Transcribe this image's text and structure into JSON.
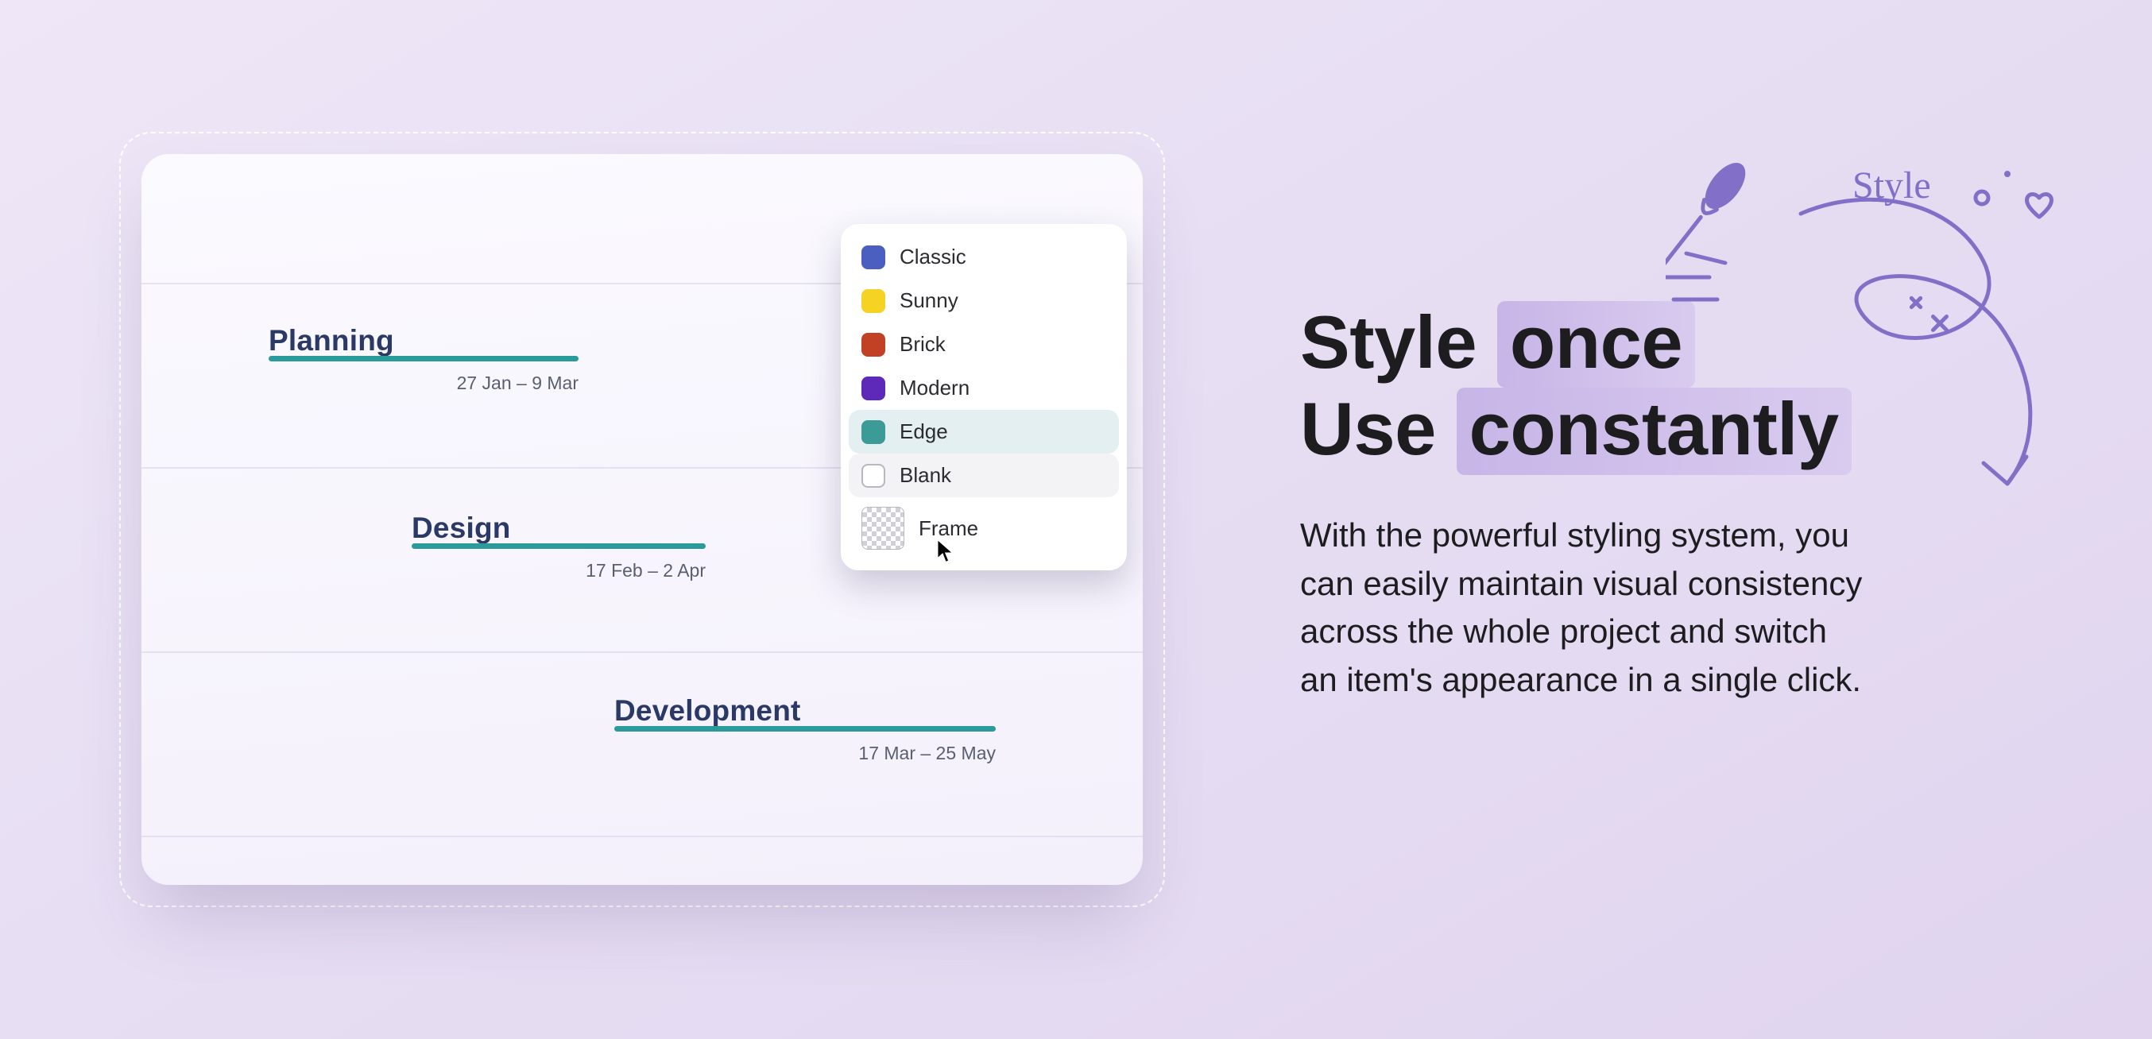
{
  "timeline": {
    "tasks": [
      {
        "title": "Planning",
        "dates": "27 Jan – 9 Mar"
      },
      {
        "title": "Design",
        "dates": "17 Feb – 2 Apr"
      },
      {
        "title": "Development",
        "dates": "17 Mar – 25 May"
      }
    ]
  },
  "styleMenu": {
    "options": [
      {
        "key": "classic",
        "label": "Classic",
        "color": "#4a5fbf",
        "state": ""
      },
      {
        "key": "sunny",
        "label": "Sunny",
        "color": "#f5d324",
        "state": ""
      },
      {
        "key": "brick",
        "label": "Brick",
        "color": "#c24024",
        "state": ""
      },
      {
        "key": "modern",
        "label": "Modern",
        "color": "#5e29b8",
        "state": ""
      },
      {
        "key": "edge",
        "label": "Edge",
        "color": "#3c9a97",
        "state": "selected"
      },
      {
        "key": "blank",
        "label": "Blank",
        "color": "#ffffff",
        "state": "hovered"
      },
      {
        "key": "frame",
        "label": "Frame",
        "color": "checker",
        "state": ""
      }
    ]
  },
  "marketing": {
    "line1_a": "Style",
    "line1_b": "once",
    "line2_a": "Use",
    "line2_b": "constantly",
    "paragraph": "With the powerful styling system, you can easily maintain visual consistency across the whole project and switch an item's appearance in a single click."
  },
  "doodle": {
    "label": "Style"
  }
}
